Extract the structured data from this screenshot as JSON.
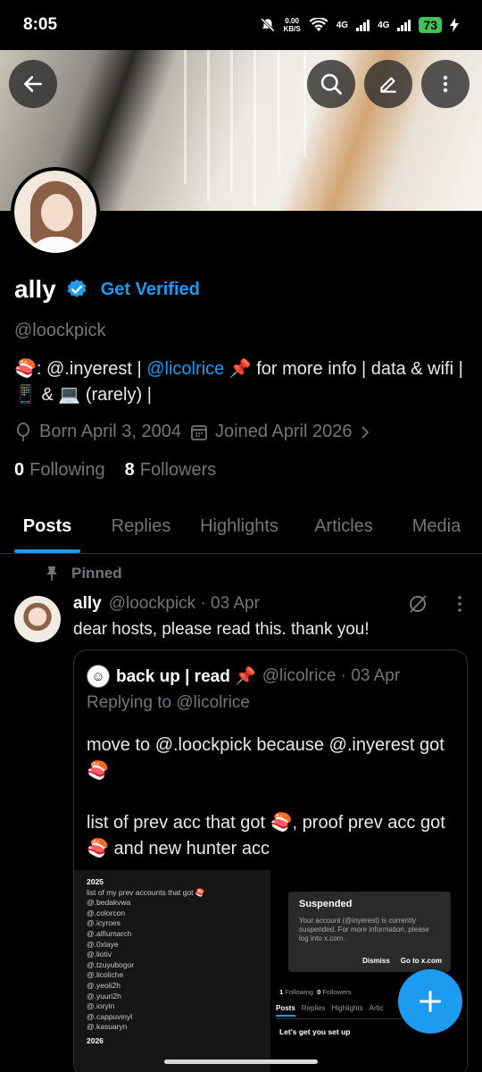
{
  "status_bar": {
    "time": "8:05",
    "net_speed_value": "0.00",
    "net_speed_unit": "KB/S",
    "network_1": "4G",
    "network_2": "4G",
    "battery": "73"
  },
  "header": {
    "back_icon": "arrow-left-icon",
    "search_icon": "search-icon",
    "edit_icon": "pencil-icon",
    "more_icon": "more-vertical-icon"
  },
  "profile": {
    "name": "ally",
    "get_verified": "Get Verified",
    "handle": "@loockpick",
    "bio": {
      "part1": "🍣: @.inyerest | ",
      "mention": "@licolrice",
      "part2": " 📌 for more info | data & wifi | 📱 & 💻 (rarely) |"
    },
    "born": "Born April 3, 2004",
    "joined": "Joined April 2026",
    "following_count": "0",
    "following_label": "Following",
    "followers_count": "8",
    "followers_label": "Followers"
  },
  "tabs": [
    {
      "label": "Posts"
    },
    {
      "label": "Replies"
    },
    {
      "label": "Highlights"
    },
    {
      "label": "Articles"
    },
    {
      "label": "Media"
    }
  ],
  "pinned_post": {
    "pinned_label": "Pinned",
    "author_name": "ally",
    "author_meta": "@loockpick · 03 Apr",
    "text": "dear hosts, please read this. thank you!",
    "quote": {
      "name": "back up | read 📌",
      "meta": "@licolrice · 03 Apr",
      "replying": "Replying to @licolrice",
      "body": "move to @.loockpick because @.inyerest got 🍣\n\nlist of prev acc that got 🍣, proof prev acc got 🍣 and new hunter acc",
      "image_left": {
        "year1": "2025",
        "heading": "list of my prev accounts that got 🍣",
        "accounts": [
          "@.bedakvwa",
          "@.colorcon",
          "@.icyroes",
          "@.alfiumarch",
          "@.0xlaye",
          "@.liotiv",
          "@.tzuyubogor",
          "@.licoliche",
          "@.yeoli2h",
          "@.yuuri2h",
          "@.ioryin",
          "@.cappuvinyl",
          "@.kasuaryn"
        ],
        "year2": "2026"
      },
      "image_right": {
        "title": "Suspended",
        "desc": "Your account (@inyerest) is currently suspended. For more information, please log into x.com.",
        "dismiss": "Dismiss",
        "go": "Go to x.com",
        "following": "1",
        "following_label": "Following",
        "followers": "0",
        "followers_label": "Followers",
        "tabs": [
          "Posts",
          "Replies",
          "Highlights",
          "Artic"
        ],
        "setup": "Let's get you set up"
      }
    }
  },
  "fab_icon": "plus-icon",
  "colors": {
    "accent": "#1d9bf0",
    "background": "#000000",
    "muted": "#71767b",
    "battery": "#3ec452"
  }
}
